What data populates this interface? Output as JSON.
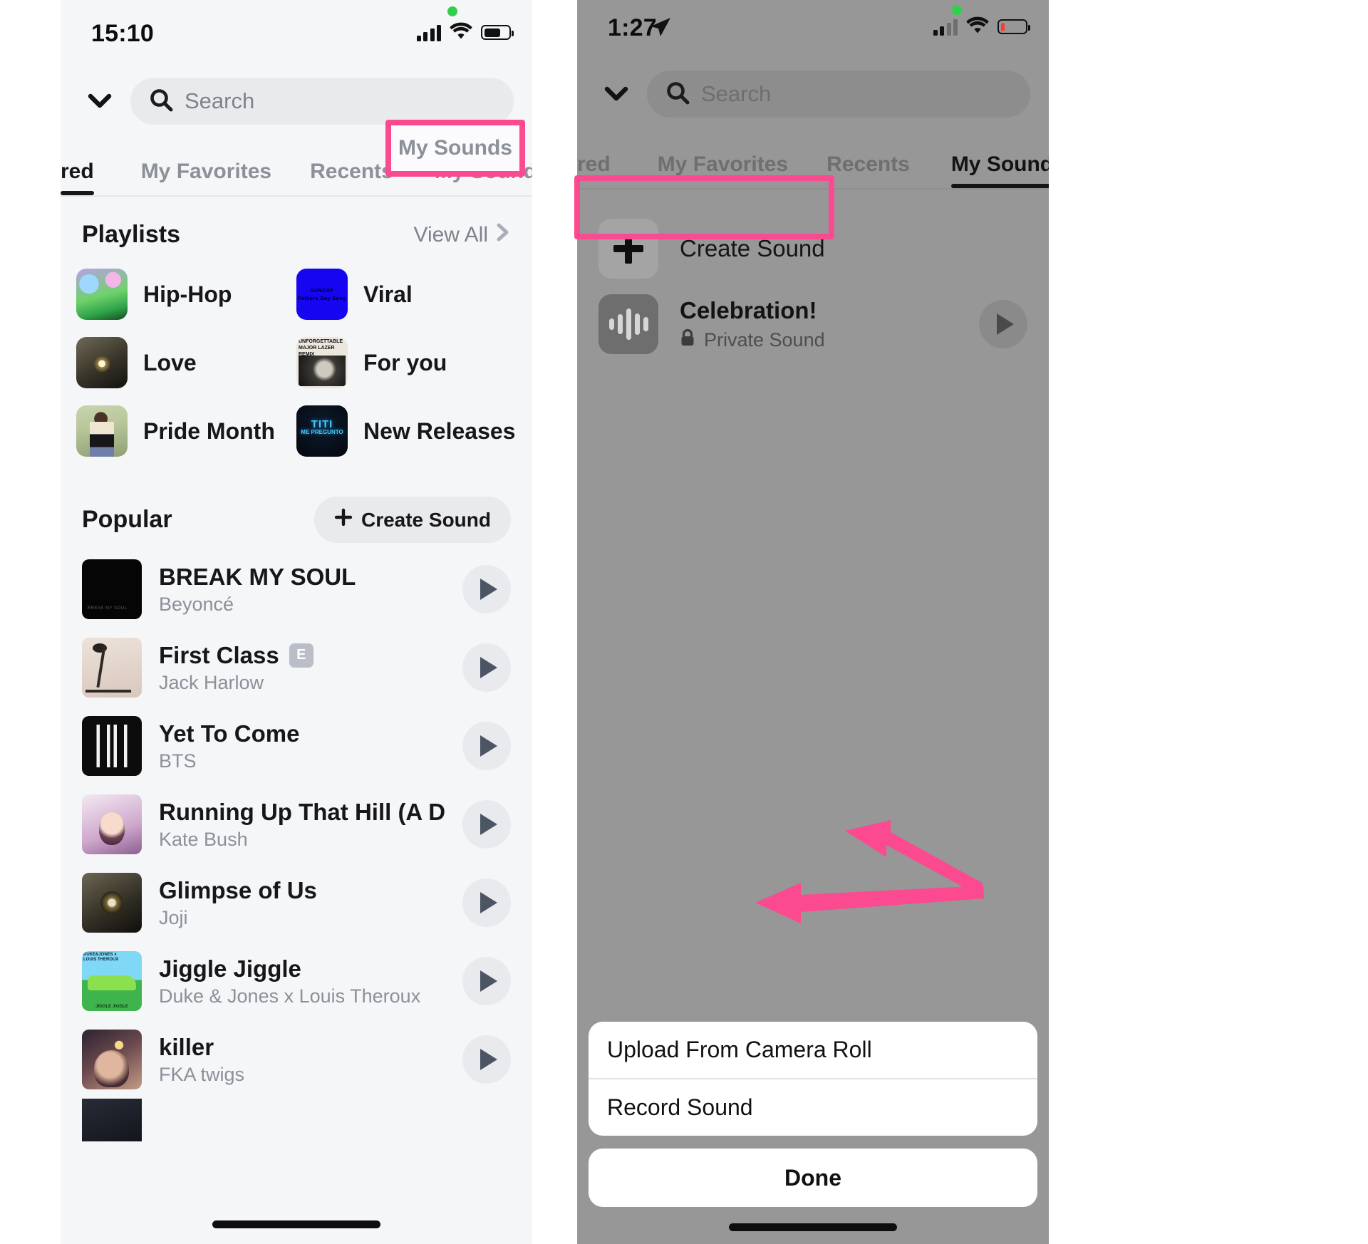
{
  "left_phone": {
    "status": {
      "time": "15:10",
      "signal_icon": "cellular-bars-icon",
      "wifi_icon": "wifi-icon",
      "battery_icon": "battery-icon"
    },
    "search": {
      "placeholder": "Search",
      "chevron_icon": "chevron-down-icon",
      "search_icon": "search-icon"
    },
    "tabs": [
      {
        "label": "red",
        "active": true
      },
      {
        "label": "My Favorites",
        "active": false
      },
      {
        "label": "Recents",
        "active": false
      },
      {
        "label": "My Sounds",
        "active": false,
        "highlighted": true
      }
    ],
    "playlists_section": {
      "title": "Playlists",
      "view_all": "View All",
      "view_all_icon": "chevron-right-icon",
      "items": [
        {
          "name": "Hip-Hop",
          "art": "art-hiphop"
        },
        {
          "name": "Viral",
          "art": "art-viral",
          "art_text": "SUNDAY\nFathers Day Song"
        },
        {
          "name": "Love",
          "art": "art-love"
        },
        {
          "name": "For you",
          "art": "art-foryou",
          "art_text": "UNFORGETTABLE\nFEATURING SWAE LEE\nMAJOR LAZER REMIX"
        },
        {
          "name": "Pride Month",
          "art": "art-pride"
        },
        {
          "name": "New Releases",
          "art": "art-new",
          "art_text": "TITI",
          "art_subtext": "ME PREGUNTO"
        }
      ]
    },
    "popular_section": {
      "title": "Popular",
      "create_sound_label": "Create Sound",
      "create_sound_icon": "plus-icon",
      "songs": [
        {
          "title": "BREAK MY SOUL",
          "artist": "Beyoncé",
          "explicit": false,
          "art": "art-bms",
          "play_icon": "play-icon"
        },
        {
          "title": "First Class",
          "artist": "Jack Harlow",
          "explicit": true,
          "explicit_badge": "E",
          "art": "art-first",
          "play_icon": "play-icon"
        },
        {
          "title": "Yet To Come",
          "artist": "BTS",
          "explicit": false,
          "art": "art-bts",
          "play_icon": "play-icon"
        },
        {
          "title": "Running Up That Hill (A Deal…",
          "artist": "Kate Bush",
          "explicit": false,
          "art": "art-kate",
          "play_icon": "play-icon"
        },
        {
          "title": "Glimpse of Us",
          "artist": "Joji",
          "explicit": false,
          "art": "art-joji",
          "play_icon": "play-icon"
        },
        {
          "title": "Jiggle Jiggle",
          "artist": "Duke & Jones x Louis Theroux",
          "explicit": false,
          "art": "art-jiggle",
          "play_icon": "play-icon"
        },
        {
          "title": "killer",
          "artist": "FKA twigs",
          "explicit": false,
          "art": "art-killer",
          "play_icon": "play-icon"
        }
      ]
    }
  },
  "right_phone": {
    "status": {
      "time": "1:27",
      "location_icon": "location-arrow-icon",
      "signal_icon": "cellular-bars-icon",
      "wifi_icon": "wifi-icon",
      "battery_icon": "battery-low-icon"
    },
    "search": {
      "placeholder": "Search",
      "chevron_icon": "chevron-down-icon",
      "search_icon": "search-icon"
    },
    "tabs": [
      {
        "label": "red",
        "active": false
      },
      {
        "label": "My Favorites",
        "active": false
      },
      {
        "label": "Recents",
        "active": false
      },
      {
        "label": "My Sounds",
        "active": true
      }
    ],
    "my_sounds": {
      "create_sound": {
        "label": "Create Sound",
        "icon": "plus-icon",
        "highlighted": true
      },
      "sounds": [
        {
          "title": "Celebration!",
          "subtitle": "Private Sound",
          "lock_icon": "lock-icon",
          "waveform_icon": "waveform-icon",
          "play_icon": "play-icon"
        }
      ]
    },
    "action_sheet": {
      "items": [
        {
          "label": "Upload From Camera Roll",
          "annotated": true
        },
        {
          "label": "Record Sound",
          "annotated": true
        }
      ],
      "done_label": "Done"
    }
  },
  "annotations": {
    "accent_color": "#fb4a8f",
    "boxes": [
      {
        "name": "my-sounds-tab-highlight",
        "target": "My Sounds"
      },
      {
        "name": "create-sound-highlight",
        "target": "Create Sound"
      }
    ],
    "arrows": [
      {
        "name": "arrow-to-upload-from-camera-roll"
      },
      {
        "name": "arrow-to-record-sound"
      }
    ]
  }
}
